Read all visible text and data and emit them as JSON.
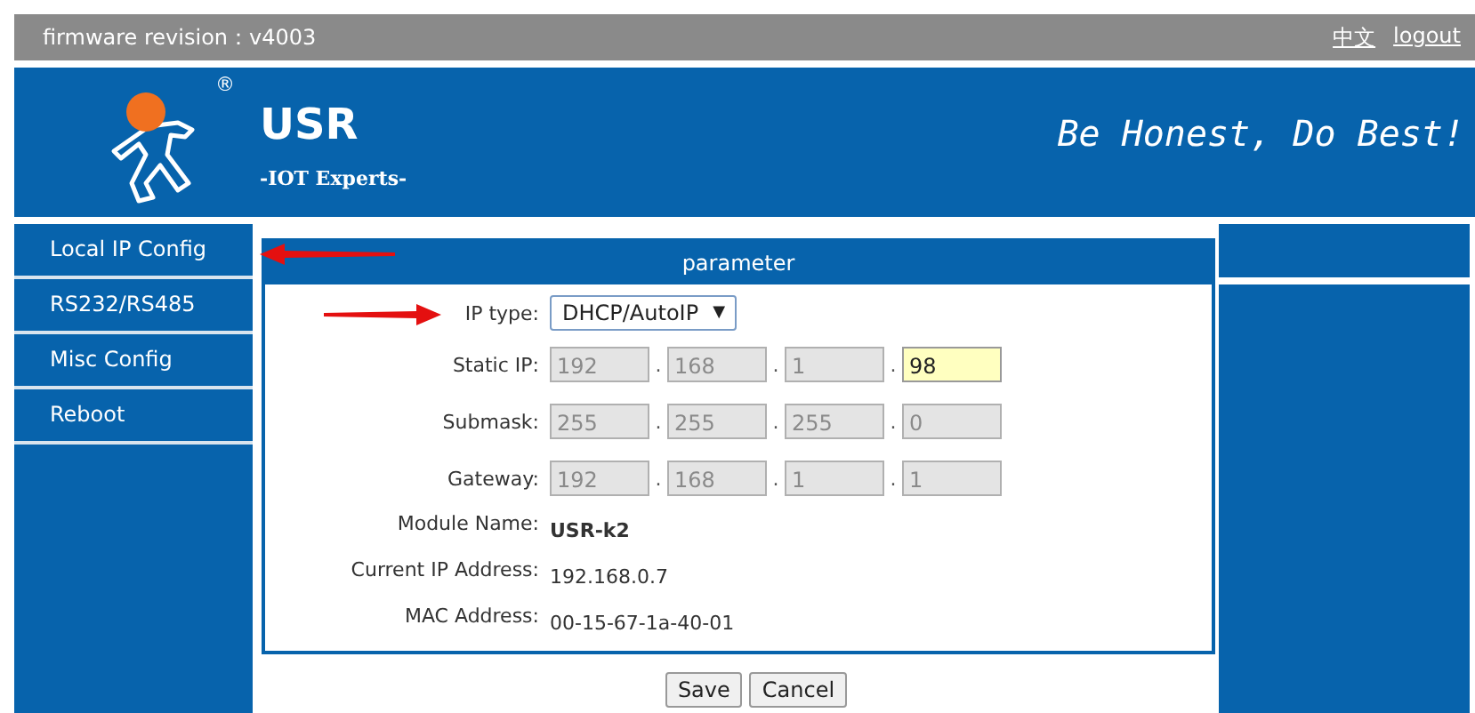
{
  "top_bar": {
    "firmware": "firmware revision：v4003",
    "links": [
      "中文",
      "logout"
    ]
  },
  "header": {
    "brand": "USR",
    "registered": "®",
    "tagline": "-IOT Experts-",
    "slogan": "Be Honest, Do Best!"
  },
  "sidebar": {
    "items": [
      "Local IP Config",
      "RS232/RS485",
      "Misc Config",
      "Reboot"
    ]
  },
  "panel": {
    "title": "parameter",
    "ip_type": {
      "label": "IP type:",
      "value": "DHCP/AutoIP",
      "caret": "▼"
    },
    "address_rows": [
      {
        "label": "Static IP:",
        "separator": ".",
        "octets": [
          {
            "value": "192",
            "disabled": true,
            "focused": false
          },
          {
            "value": "168",
            "disabled": true,
            "focused": false
          },
          {
            "value": "1",
            "disabled": true,
            "focused": false
          },
          {
            "value": "98",
            "disabled": false,
            "focused": true
          }
        ]
      },
      {
        "label": "Submask:",
        "separator": ".",
        "octets": [
          {
            "value": "255",
            "disabled": true,
            "focused": false
          },
          {
            "value": "255",
            "disabled": true,
            "focused": false
          },
          {
            "value": "255",
            "disabled": true,
            "focused": false
          },
          {
            "value": "0",
            "disabled": true,
            "focused": false
          }
        ]
      },
      {
        "label": "Gateway:",
        "separator": ".",
        "octets": [
          {
            "value": "192",
            "disabled": true,
            "focused": false
          },
          {
            "value": "168",
            "disabled": true,
            "focused": false
          },
          {
            "value": "1",
            "disabled": true,
            "focused": false
          },
          {
            "value": "1",
            "disabled": true,
            "focused": false
          }
        ]
      }
    ],
    "info_rows": [
      {
        "label": "Module Name:",
        "value": "USR-k2",
        "bold": true
      },
      {
        "label": "Current IP Address:",
        "value": "192.168.0.7",
        "bold": false
      },
      {
        "label": "MAC Address:",
        "value": "00-15-67-1a-40-01",
        "bold": false
      }
    ]
  },
  "buttons": [
    "Save",
    "Cancel"
  ]
}
